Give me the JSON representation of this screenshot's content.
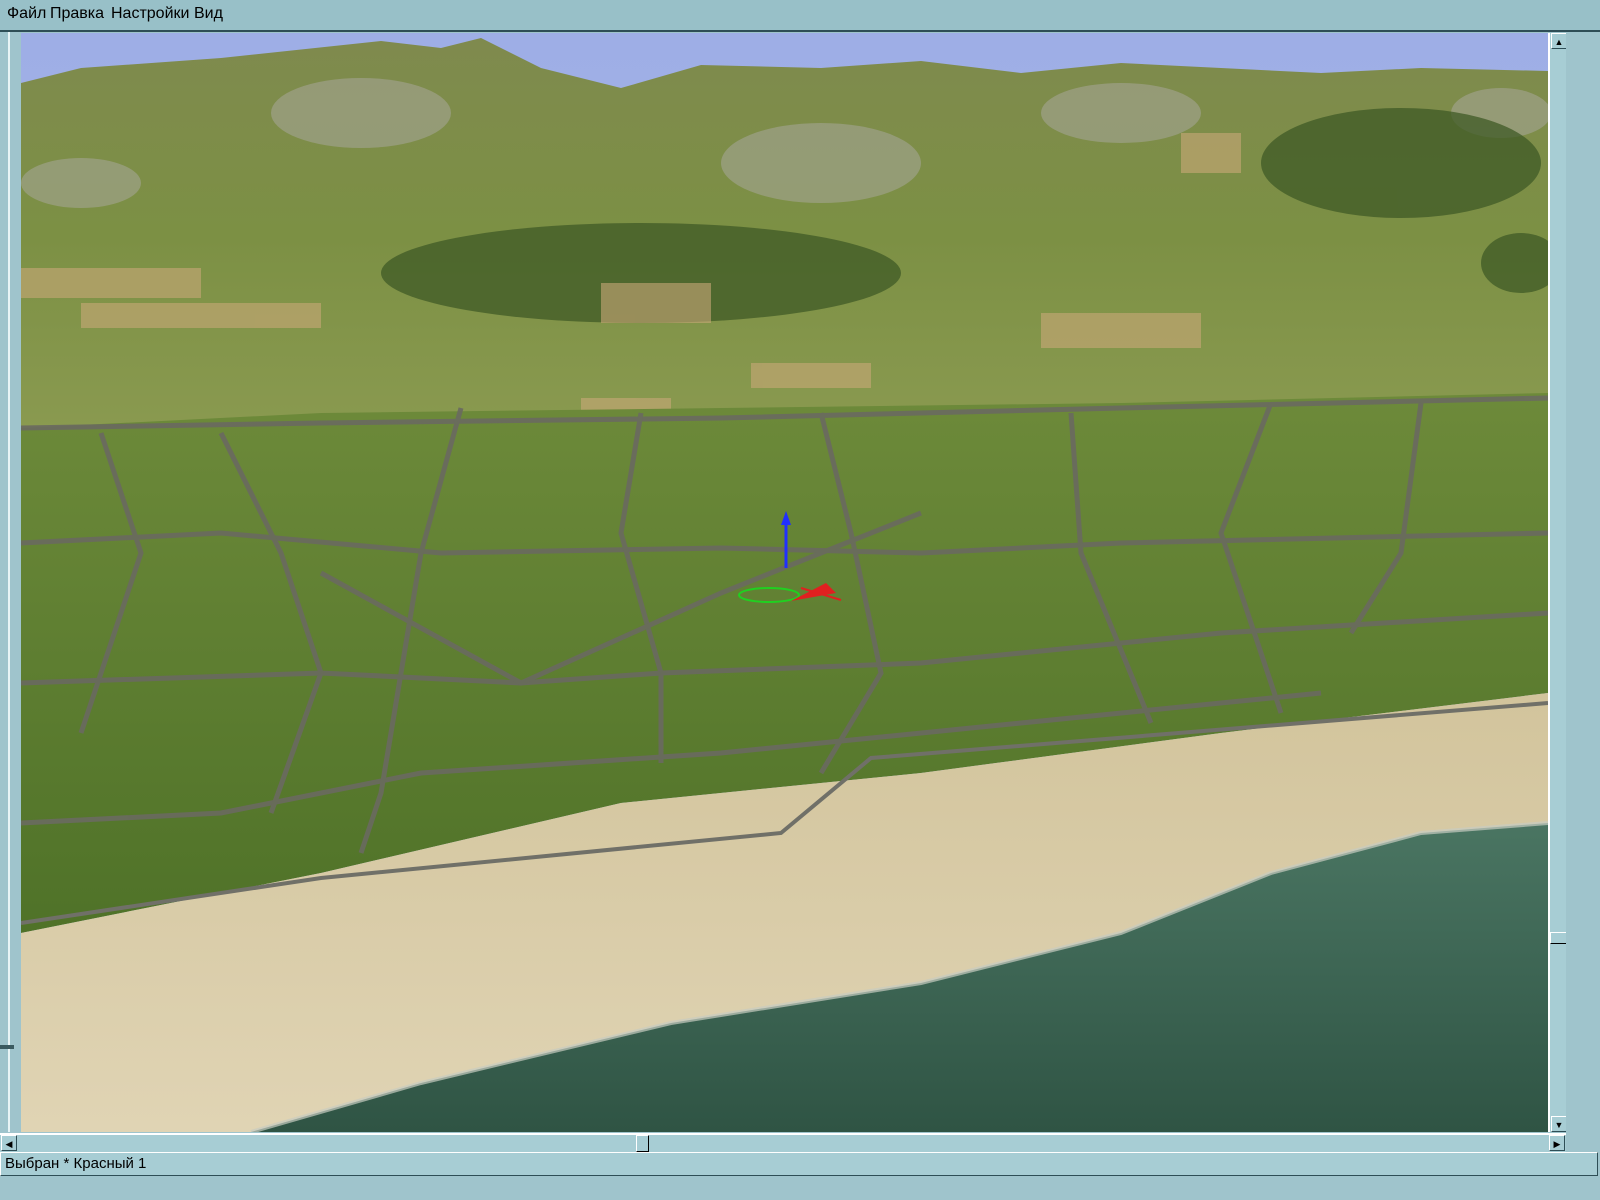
{
  "menu": {
    "items": [
      "Файл",
      "Правка",
      "Настройки",
      "Вид"
    ]
  },
  "viewport": {
    "label": "3d-terrain-view"
  },
  "scrollbars": {
    "vertical": {
      "position_fraction": 0.83
    },
    "horizontal": {
      "position_fraction": 0.41
    }
  },
  "status": {
    "text": "Выбран * Красный 1"
  },
  "colors": {
    "chrome": "#9fc4cc",
    "sky": "#a3b3e6",
    "grass": "#7d8f45",
    "sand": "#d8c8a0",
    "sea": "#3c6552"
  }
}
